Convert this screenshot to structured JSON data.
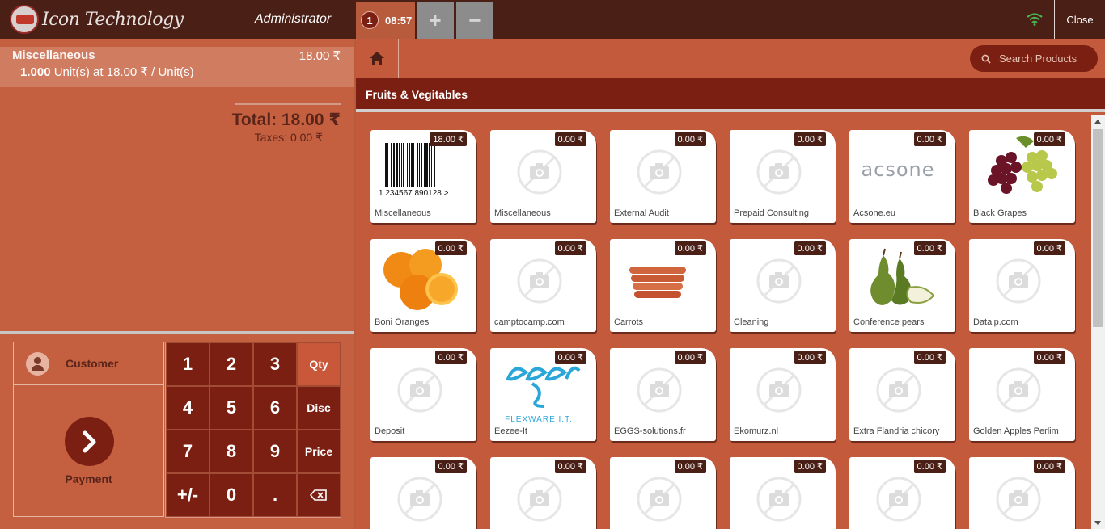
{
  "header": {
    "brand": "Icon Technology",
    "user": "Administrator",
    "order": {
      "number": "1",
      "time": "08:57"
    },
    "add_label": "+",
    "remove_label": "−",
    "close_label": "Close"
  },
  "order_line": {
    "product": "Miscellaneous",
    "price": "18.00 ₹",
    "qty": "1.000",
    "unit_text": "Unit(s) at 18.00 ₹ / Unit(s)"
  },
  "summary": {
    "total": "Total: 18.00 ₹",
    "taxes": "Taxes: 0.00 ₹"
  },
  "actions": {
    "customer": "Customer",
    "payment": "Payment"
  },
  "numpad": {
    "k1": "1",
    "k2": "2",
    "k3": "3",
    "qty": "Qty",
    "k4": "4",
    "k5": "5",
    "k6": "6",
    "disc": "Disc",
    "k7": "7",
    "k8": "8",
    "k9": "9",
    "price": "Price",
    "sign": "+/-",
    "k0": "0",
    "dot": "."
  },
  "search": {
    "placeholder": "Search Products"
  },
  "category": {
    "title": "Fruits & Vegitables"
  },
  "products": [
    {
      "name": "Miscellaneous",
      "price": "18.00 ₹",
      "image": "barcode"
    },
    {
      "name": "Miscellaneous",
      "price": "0.00 ₹",
      "image": "no-photo"
    },
    {
      "name": "External Audit",
      "price": "0.00 ₹",
      "image": "no-photo"
    },
    {
      "name": "Prepaid Consulting",
      "price": "0.00 ₹",
      "image": "no-photo"
    },
    {
      "name": "Acsone.eu",
      "price": "0.00 ₹",
      "image": "acsone-logo"
    },
    {
      "name": "Black Grapes",
      "price": "0.00 ₹",
      "image": "grapes"
    },
    {
      "name": "Boni Oranges",
      "price": "0.00 ₹",
      "image": "oranges"
    },
    {
      "name": "camptocamp.com",
      "price": "0.00 ₹",
      "image": "no-photo"
    },
    {
      "name": "Carrots",
      "price": "0.00 ₹",
      "image": "carrots"
    },
    {
      "name": "Cleaning",
      "price": "0.00 ₹",
      "image": "no-photo"
    },
    {
      "name": "Conference pears",
      "price": "0.00 ₹",
      "image": "pears"
    },
    {
      "name": "Datalp.com",
      "price": "0.00 ₹",
      "image": "no-photo"
    },
    {
      "name": "Deposit",
      "price": "0.00 ₹",
      "image": "no-photo"
    },
    {
      "name": "Eezee-It",
      "price": "0.00 ₹",
      "image": "eezee-logo"
    },
    {
      "name": "EGGS-solutions.fr",
      "price": "0.00 ₹",
      "image": "no-photo"
    },
    {
      "name": "Ekomurz.nl",
      "price": "0.00 ₹",
      "image": "no-photo"
    },
    {
      "name": "Extra Flandria chicory",
      "price": "0.00 ₹",
      "image": "no-photo"
    },
    {
      "name": "Golden Apples Perlim",
      "price": "0.00 ₹",
      "image": "no-photo"
    },
    {
      "name": "",
      "price": "0.00 ₹",
      "image": "no-photo"
    },
    {
      "name": "",
      "price": "0.00 ₹",
      "image": "no-photo"
    },
    {
      "name": "",
      "price": "0.00 ₹",
      "image": "no-photo"
    },
    {
      "name": "",
      "price": "0.00 ₹",
      "image": "no-photo"
    },
    {
      "name": "",
      "price": "0.00 ₹",
      "image": "no-photo"
    },
    {
      "name": "",
      "price": "0.00 ₹",
      "image": "no-photo"
    }
  ],
  "product_image_text": {
    "barcode_digits": "1 234567 890128 >",
    "acsone": "acsone",
    "eezee_sub": "FLEXWARE I.T."
  }
}
